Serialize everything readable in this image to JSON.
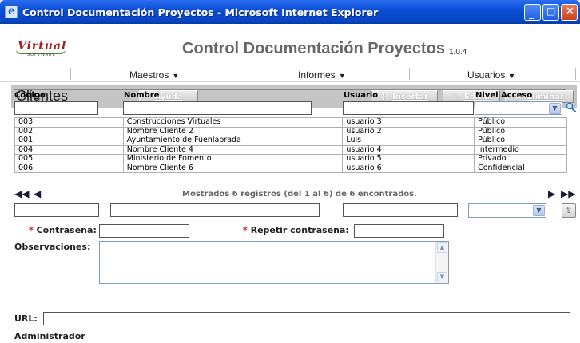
{
  "window": {
    "title": "Control Documentación Proyectos - Microsoft Internet Explorer"
  },
  "header": {
    "logo_script": "Virtual",
    "logo_sub": "SOFTWARE",
    "app_title": "Control Documentación Proyectos",
    "version": "1.0.4"
  },
  "menu": {
    "items": [
      {
        "label": "Maestros"
      },
      {
        "label": "Informes"
      },
      {
        "label": "Usuarios"
      }
    ]
  },
  "toolbar": {
    "section_title": "Clientes",
    "help_label": "Ayuda",
    "insert_label": "Insertar",
    "edit_label": "Editar",
    "delete_label": "Eliminar"
  },
  "grid": {
    "columns": [
      "Código",
      "Nombre",
      "Usuario",
      "Nivel Acceso"
    ],
    "rows": [
      [
        "003",
        "Construcciones Virtuales",
        "usuario 3",
        "Público"
      ],
      [
        "002",
        "Nombre Cliente 2",
        "usuario 2",
        "Público"
      ],
      [
        "001",
        "Ayuntamiento de Fuenlabrada",
        "Luis",
        "Público"
      ],
      [
        "004",
        "Nombre Cliente 4",
        "usuario 4",
        "Intermedio"
      ],
      [
        "005",
        "Ministerio de Fomento",
        "usuario 5",
        "Privado"
      ],
      [
        "006",
        "Nombre Cliente 6",
        "usuario 6",
        "Confidencial"
      ]
    ],
    "pager_info": "Mostrados 6 registros (del 1 al 6) de 6 encontrados."
  },
  "form": {
    "password_label": "Contraseña:",
    "repeat_password_label": "Repetir contraseña:",
    "required_mark": "*",
    "observations_label": "Observaciones:",
    "url_label": "URL:",
    "footer": "Administrador"
  }
}
